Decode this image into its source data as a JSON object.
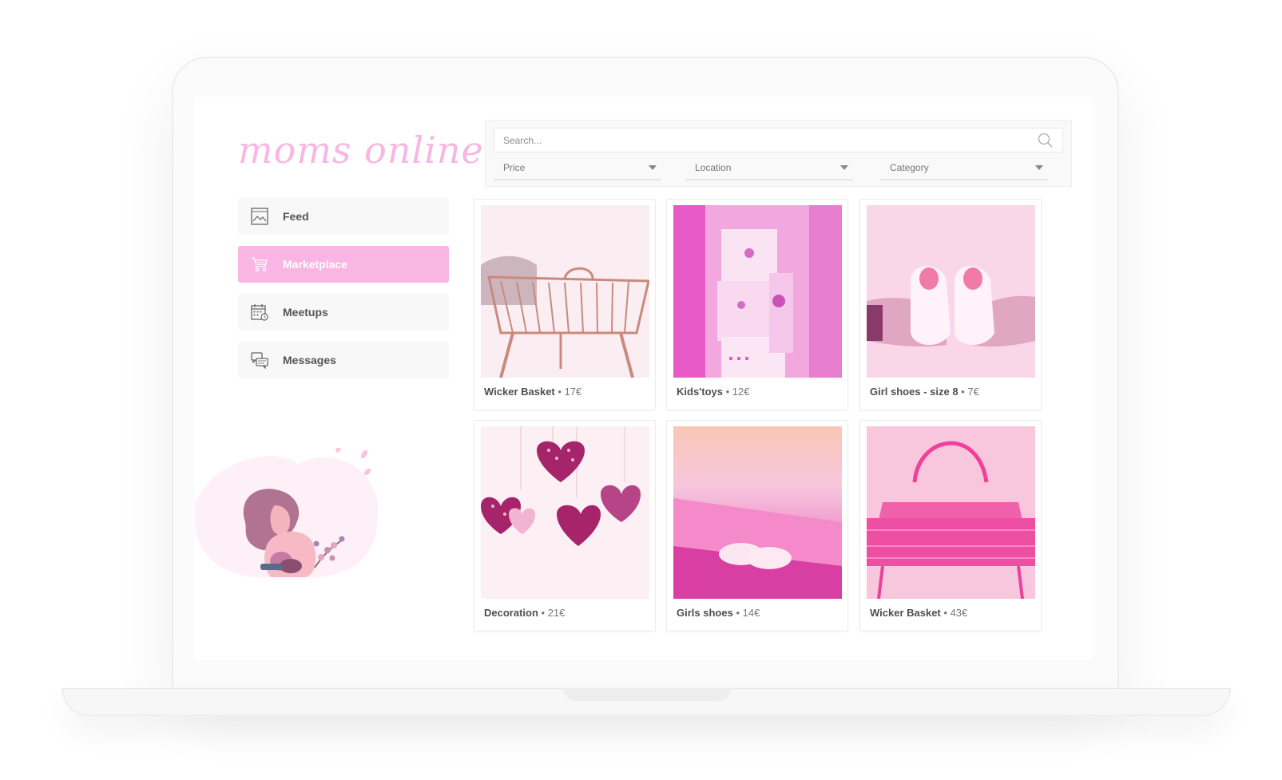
{
  "app": {
    "logo_text": "moms online"
  },
  "sidebar": {
    "items": [
      {
        "label": "Feed",
        "icon": "image-icon",
        "active": false
      },
      {
        "label": "Marketplace",
        "icon": "cart-icon",
        "active": true
      },
      {
        "label": "Meetups",
        "icon": "calendar-icon",
        "active": false
      },
      {
        "label": "Messages",
        "icon": "chat-icon",
        "active": false
      }
    ]
  },
  "search": {
    "placeholder": "Search...",
    "value": ""
  },
  "filters": [
    {
      "label": "Price"
    },
    {
      "label": "Location"
    },
    {
      "label": "Category"
    }
  ],
  "products": [
    {
      "name": "Wicker Basket ",
      "price": "17€",
      "image": "wicker-basket-cradle"
    },
    {
      "name": "Kids'toys",
      "price": "12€",
      "image": "toy-blocks"
    },
    {
      "name": "Girl shoes - size 8",
      "price": "7€",
      "image": "baby-shoes-in-hands"
    },
    {
      "name": "Decoration",
      "price": "21€",
      "image": "heart-mobile"
    },
    {
      "name": "Girls shoes",
      "price": "14€",
      "image": "knitted-booties"
    },
    {
      "name": "Wicker Basket",
      "price": "43€",
      "image": "pink-bassinet"
    }
  ],
  "colors": {
    "accent": "#f9b5e3",
    "logo": "#f7b7e2",
    "nav_bg": "#f8f8f8",
    "text": "#555555"
  }
}
